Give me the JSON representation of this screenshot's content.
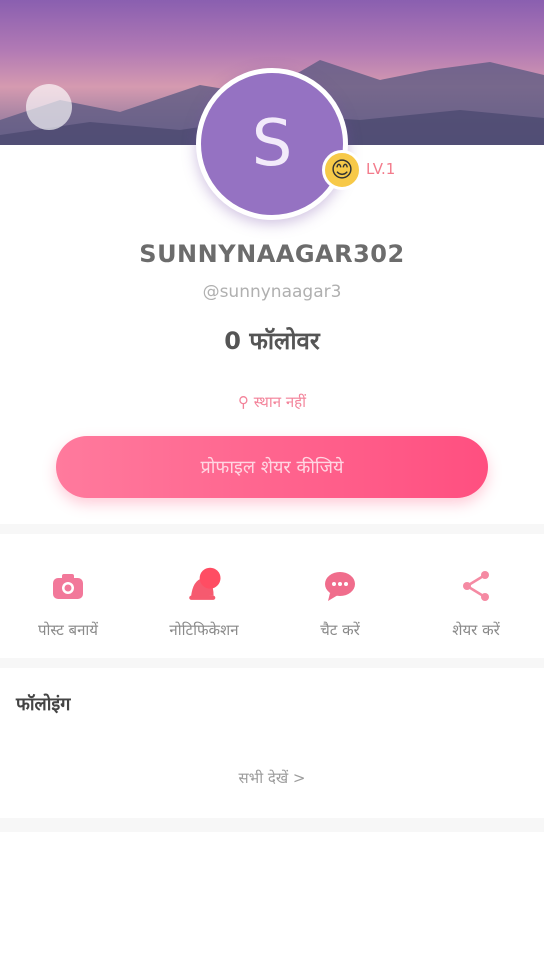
{
  "profile": {
    "avatar_letter": "S",
    "level_badge_emoji": "😊",
    "level_label": "LV.1",
    "username": "SUNNYNAAGAR302",
    "handle": "@sunnynaagar3",
    "followers": "0 फॉलोवर",
    "location": "स्थान नहीं"
  },
  "share_profile_label": "प्रोफाइल शेयर कीजिये",
  "actions": [
    {
      "label": "पोस्ट बनायें",
      "icon": "camera-icon"
    },
    {
      "label": "नोटिफिकेशन",
      "icon": "bell-icon"
    },
    {
      "label": "चैट करें",
      "icon": "chat-icon"
    },
    {
      "label": "शेयर करें",
      "icon": "share-icon"
    }
  ],
  "following": {
    "title": "फॉलोइंग",
    "see_all": "सभी देखें >"
  },
  "colors": {
    "accent": "#ff5a86",
    "avatar": "#9572c2",
    "cover_top": "#8a5fb0",
    "cover_mid": "#d59ab0"
  }
}
